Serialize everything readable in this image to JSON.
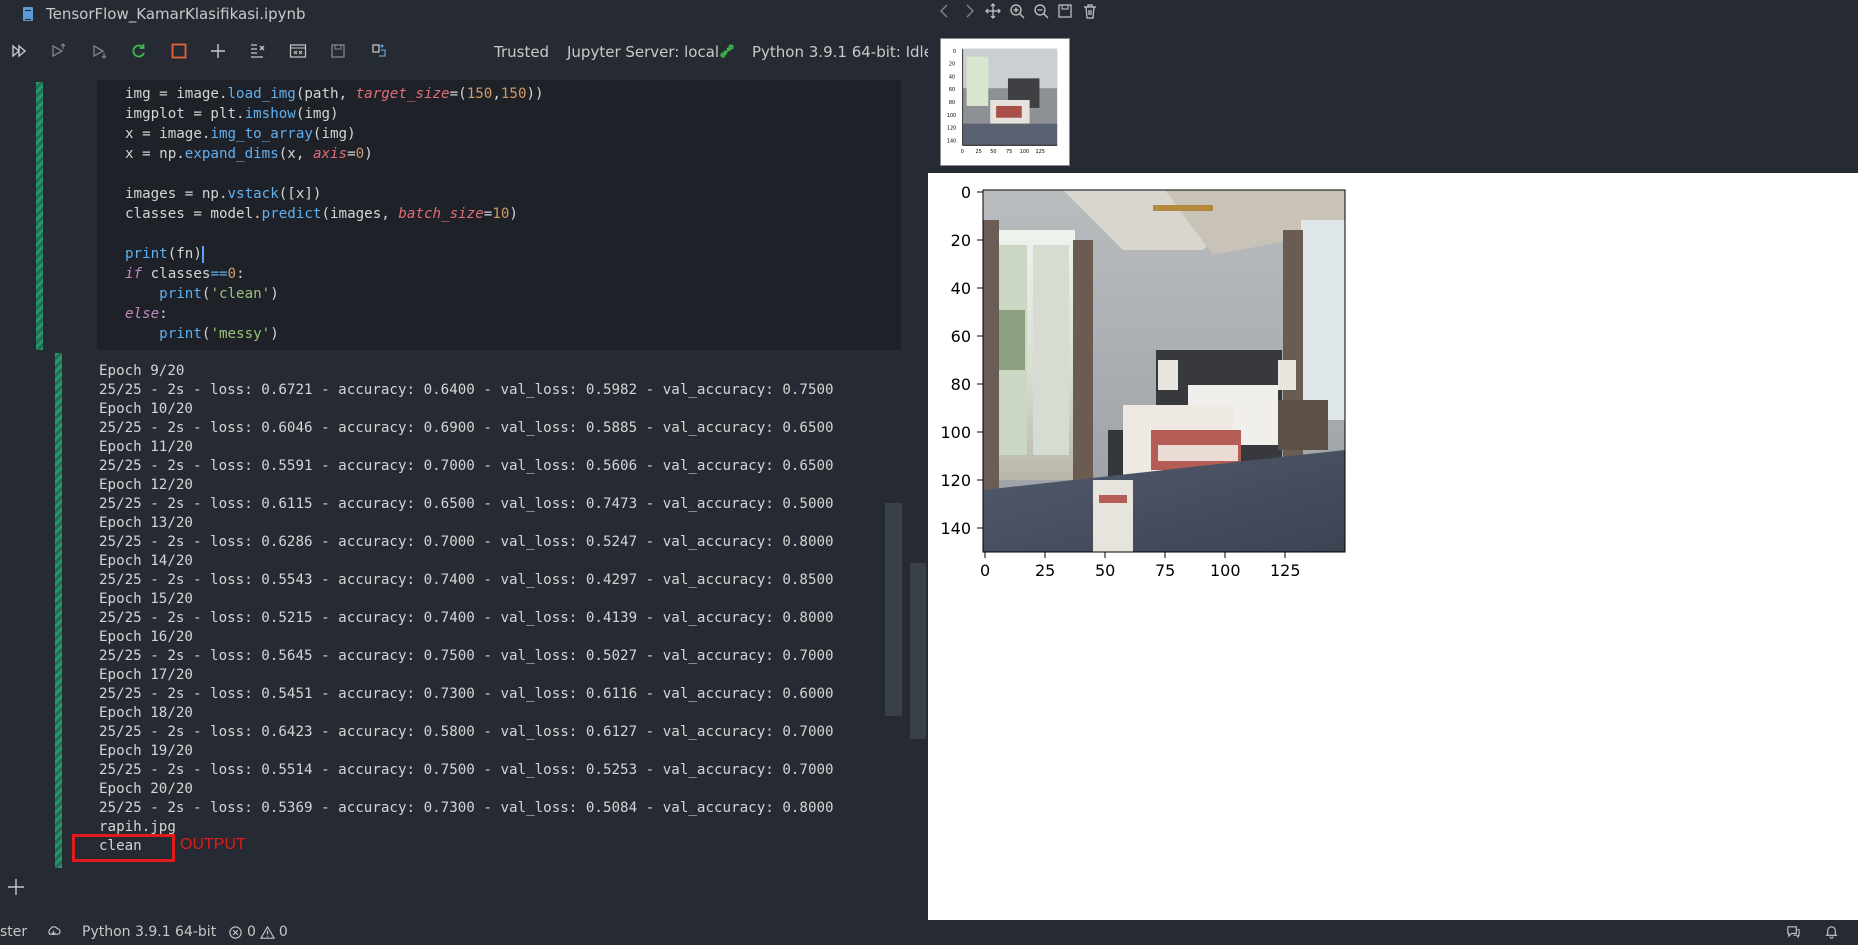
{
  "window": {
    "tab_title": "TensorFlow_KamarKlasifikasi.ipynb"
  },
  "toolbar": {
    "trusted": "Trusted",
    "server": "Jupyter Server: local",
    "kernel": "Python 3.9.1 64-bit: Idle",
    "icons": [
      "run-all-icon",
      "run-above-icon",
      "run-below-icon",
      "restart-icon",
      "interrupt-icon",
      "add-icon",
      "clear-outputs-icon",
      "variables-icon",
      "save-icon",
      "export-icon"
    ]
  },
  "code": {
    "lines": [
      "img = image.load_img(path, target_size=(150,150))",
      "imgplot = plt.imshow(img)",
      "x = image.img_to_array(img)",
      "x = np.expand_dims(x, axis=0)",
      "",
      "images = np.vstack([x])",
      "classes = model.predict(images, batch_size=10)",
      "",
      "print(fn)",
      "if classes==0:",
      "    print('clean')",
      "else:",
      "    print('messy')"
    ]
  },
  "output": {
    "lines": [
      "Epoch 9/20",
      "25/25 - 2s - loss: 0.6721 - accuracy: 0.6400 - val_loss: 0.5982 - val_accuracy: 0.7500",
      "Epoch 10/20",
      "25/25 - 2s - loss: 0.6046 - accuracy: 0.6900 - val_loss: 0.5885 - val_accuracy: 0.6500",
      "Epoch 11/20",
      "25/25 - 2s - loss: 0.5591 - accuracy: 0.7000 - val_loss: 0.5606 - val_accuracy: 0.6500",
      "Epoch 12/20",
      "25/25 - 2s - loss: 0.6115 - accuracy: 0.6500 - val_loss: 0.7473 - val_accuracy: 0.5000",
      "Epoch 13/20",
      "25/25 - 2s - loss: 0.6286 - accuracy: 0.7000 - val_loss: 0.5247 - val_accuracy: 0.8000",
      "Epoch 14/20",
      "25/25 - 2s - loss: 0.5543 - accuracy: 0.7400 - val_loss: 0.4297 - val_accuracy: 0.8500",
      "Epoch 15/20",
      "25/25 - 2s - loss: 0.5215 - accuracy: 0.7400 - val_loss: 0.4139 - val_accuracy: 0.8000",
      "Epoch 16/20",
      "25/25 - 2s - loss: 0.5645 - accuracy: 0.7500 - val_loss: 0.5027 - val_accuracy: 0.7000",
      "Epoch 17/20",
      "25/25 - 2s - loss: 0.5451 - accuracy: 0.7300 - val_loss: 0.6116 - val_accuracy: 0.6000",
      "Epoch 18/20",
      "25/25 - 2s - loss: 0.6423 - accuracy: 0.5800 - val_loss: 0.6127 - val_accuracy: 0.7000",
      "Epoch 19/20",
      "25/25 - 2s - loss: 0.5514 - accuracy: 0.7500 - val_loss: 0.5253 - val_accuracy: 0.7000",
      "Epoch 20/20",
      "25/25 - 2s - loss: 0.5369 - accuracy: 0.7300 - val_loss: 0.5084 - val_accuracy: 0.8000",
      "rapih.jpg",
      "clean"
    ],
    "annotation": "OUTPUT"
  },
  "plot": {
    "y_ticks": [
      "0",
      "20",
      "40",
      "60",
      "80",
      "100",
      "120",
      "140"
    ],
    "x_ticks": [
      "0",
      "25",
      "50",
      "75",
      "100",
      "125"
    ],
    "icons": [
      "back-icon",
      "forward-icon",
      "pan-icon",
      "zoom-in-icon",
      "zoom-out-icon",
      "save-plot-icon",
      "delete-plot-icon"
    ]
  },
  "statusbar": {
    "branch": "ster",
    "interpreter": "Python 3.9.1 64-bit",
    "errors": "0",
    "warnings": "0"
  },
  "colors": {
    "highlight": "#e01b1b",
    "cell_bar": "#1f9b6b",
    "restart": "#3fb950",
    "interrupt": "#e8613a"
  }
}
